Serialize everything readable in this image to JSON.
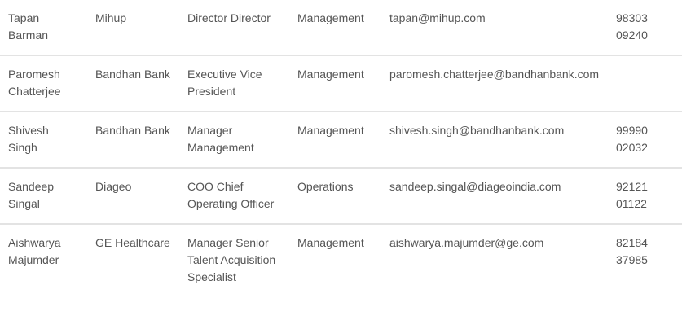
{
  "contacts": [
    {
      "name": "Tapan Barman",
      "company": "Mihup",
      "title": "Director Director",
      "department": "Management",
      "email": "tapan@mihup.com",
      "phone": "98303 09240"
    },
    {
      "name": "Paromesh Chatterjee",
      "company": "Bandhan Bank",
      "title": "Executive Vice President",
      "department": "Management",
      "email": "paromesh.chatterjee@bandhanbank.com",
      "phone": ""
    },
    {
      "name": "Shivesh Singh",
      "company": "Bandhan Bank",
      "title": "Manager Management",
      "department": "Management",
      "email": "shivesh.singh@bandhanbank.com",
      "phone": "99990 02032"
    },
    {
      "name": "Sandeep Singal",
      "company": "Diageo",
      "title": "COO Chief Operating Officer",
      "department": "Operations",
      "email": "sandeep.singal@diageoindia.com",
      "phone": "92121 01122"
    },
    {
      "name": "Aishwarya Majumder",
      "company": "GE Healthcare",
      "title": "Manager Senior Talent Acquisition Specialist",
      "department": "Management",
      "email": "aishwarya.majumder@ge.com",
      "phone": "82184 37985"
    }
  ]
}
